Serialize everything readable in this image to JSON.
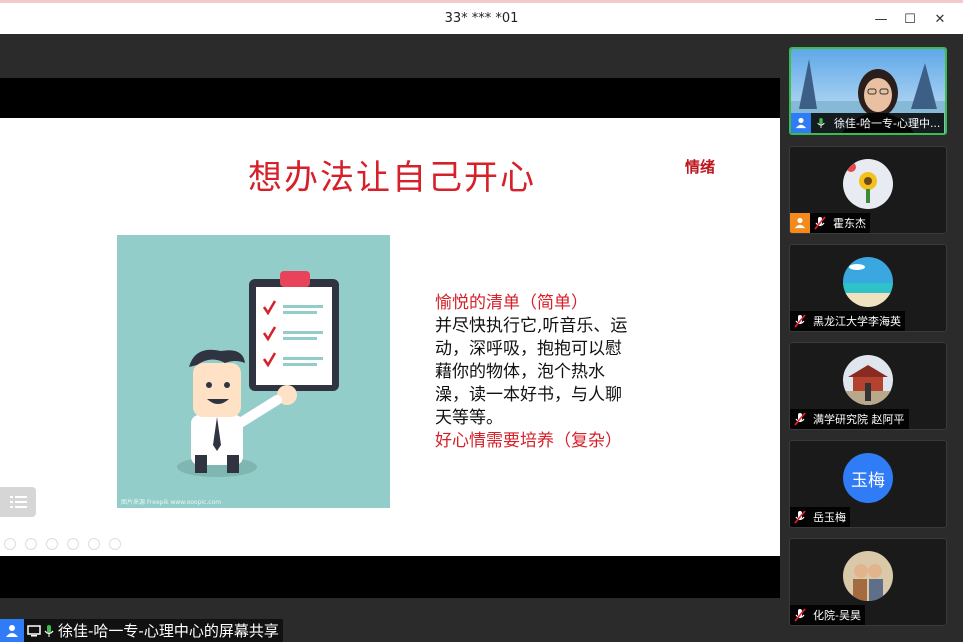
{
  "window": {
    "title": "33* *** *01",
    "minimize_glyph": "—",
    "maximize_glyph": "☐",
    "close_glyph": "✕"
  },
  "slide": {
    "title": "想办法让自己开心",
    "tag": "情绪",
    "watermark": "图片来源 Freepik www.ooopic.com",
    "text": {
      "heading": "愉悦的清单（简单）",
      "body": "并尽快执行它,听音乐、运动，深呼吸，抱抱可以慰藉你的物体，泡个热水澡，读一本好书，与人聊天等等。",
      "footer": "好心情需要培养（复杂）"
    }
  },
  "share_status": {
    "label": "徐佳-哈一专-心理中心的屏幕共享",
    "icon": "screen-share-icon"
  },
  "participants": [
    {
      "name": "徐佳-哈一专-心理中...",
      "mic": "on",
      "role_badge": "host",
      "video": "camera",
      "active": true
    },
    {
      "name": "霍东杰",
      "mic": "muted",
      "role_badge": "co-host",
      "video": "avatar-sunflower"
    },
    {
      "name": "黑龙江大学李海英",
      "mic": "muted",
      "video": "avatar-beach"
    },
    {
      "name": "满学研究院 赵阿平",
      "mic": "muted",
      "video": "avatar-temple"
    },
    {
      "name": "岳玉梅",
      "mic": "muted",
      "video": "initials",
      "initials": "玉梅"
    },
    {
      "name": "化院-吴昊",
      "mic": "muted",
      "video": "avatar-couple"
    }
  ],
  "colors": {
    "accent_blue": "#2f7cf6",
    "active_green": "#3dbb4d",
    "slide_red": "#d6202a",
    "illus_teal": "#93cdc9",
    "cohost_orange": "#f28a1c"
  }
}
